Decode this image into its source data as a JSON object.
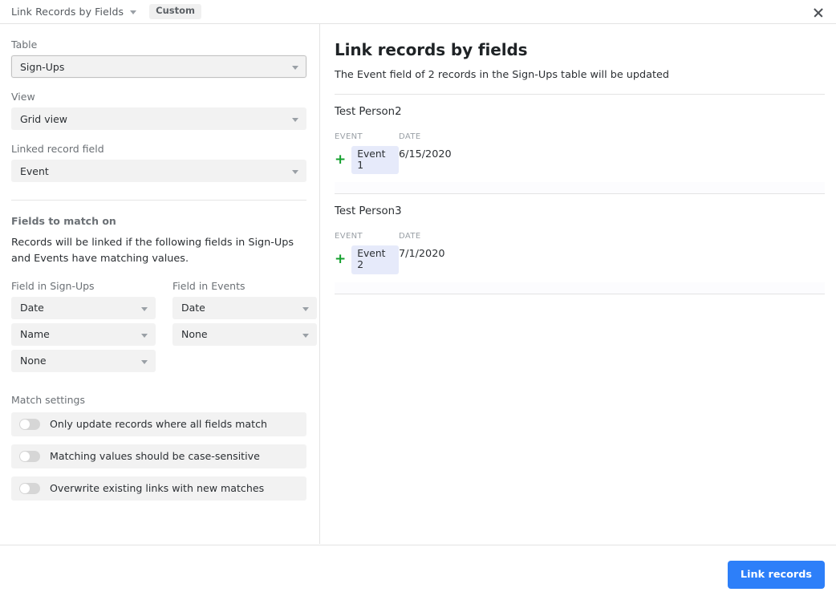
{
  "window": {
    "title": "Link Records by Fields",
    "badge": "Custom",
    "close_label": "×"
  },
  "sidebar": {
    "table": {
      "label": "Table",
      "value": "Sign-Ups"
    },
    "view": {
      "label": "View",
      "value": "Grid view"
    },
    "linked_record_field": {
      "label": "Linked record field",
      "value": "Event"
    },
    "fields_to_match": {
      "title": "Fields to match on",
      "description": "Records will be linked if the following fields in Sign-Ups and Events have matching values.",
      "left_column_label": "Field in Sign-Ups",
      "right_column_label": "Field in Events",
      "left_values": [
        "Date",
        "Name",
        "None"
      ],
      "right_values": [
        "Date",
        "None"
      ]
    },
    "match_settings": {
      "title": "Match settings",
      "toggles": [
        {
          "label": "Only update records where all fields match",
          "on": false
        },
        {
          "label": "Matching values should be case-sensitive",
          "on": false
        },
        {
          "label": "Overwrite existing links with new matches",
          "on": false
        }
      ]
    }
  },
  "main": {
    "title": "Link records by fields",
    "subtitle": "The Event field of 2 records in the Sign-Ups table will be updated",
    "column_headers": {
      "event": "EVENT",
      "date": "DATE"
    },
    "records": [
      {
        "name": "Test Person2",
        "event": "Event 1",
        "date": "6/15/2020"
      },
      {
        "name": "Test Person3",
        "event": "Event 2",
        "date": "7/1/2020"
      }
    ]
  },
  "footer": {
    "primary_button": "Link records"
  },
  "colors": {
    "accent": "#2d7ff9",
    "chip_bg": "#e6eafa",
    "plus_green": "#14a02e",
    "field_bg": "#f2f2f2"
  }
}
